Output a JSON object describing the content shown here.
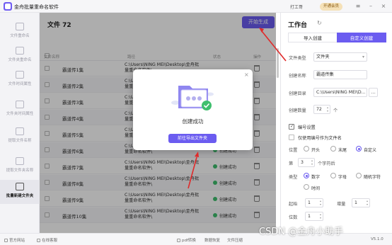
{
  "app": {
    "title": "金舟批量重命名软件",
    "user": "打工哥",
    "vip": "开通会员"
  },
  "sidebar": {
    "items": [
      {
        "label": "文件重命名"
      },
      {
        "label": "文件夹重命名"
      },
      {
        "label": "文件时间属性"
      },
      {
        "label": "文件夹时间属性"
      },
      {
        "label": "提取文件名称"
      },
      {
        "label": "提取文件夹名称"
      },
      {
        "label": "批量新建文件夹"
      }
    ],
    "active_index": 6
  },
  "main": {
    "file_count": "文件 72",
    "start_button": "开始生成",
    "columns": {
      "name": "文件名称",
      "path": "路径",
      "status": "状态",
      "action": "操作"
    },
    "rows": [
      {
        "name": "霸道传1集",
        "path": "C:\\Users\\NING MEI\\Desktop\\金舟批量重命名软件\\",
        "status": ""
      },
      {
        "name": "霸道传2集",
        "path": "C:\\Users\\NING MEI\\Desktop\\金舟批量重命名软件\\",
        "status": ""
      },
      {
        "name": "霸道传3集",
        "path": "C:\\Users\\NING MEI\\Desktop\\金舟批量重命名软件\\",
        "status": ""
      },
      {
        "name": "霸道传4集",
        "path": "C:\\Users\\NING MEI\\Desktop\\金舟批量重命名软件\\",
        "status": ""
      },
      {
        "name": "霸道传5集",
        "path": "C:\\Users\\NING MEI\\Desktop\\金舟批量重命名软件\\",
        "status": ""
      },
      {
        "name": "霸道传6集",
        "path": "C:\\Users\\NING MEI\\Desktop\\金舟批量重命名软件\\",
        "status": "创建成功"
      },
      {
        "name": "霸道传7集",
        "path": "C:\\Users\\NING MEI\\Desktop\\金舟批量重命名软件\\",
        "status": "创建成功"
      },
      {
        "name": "霸道传8集",
        "path": "C:\\Users\\NING MEI\\Desktop\\金舟批量重命名软件\\",
        "status": "创建成功"
      },
      {
        "name": "霸道传9集",
        "path": "C:\\Users\\NING MEI\\Desktop\\金舟批量重命名软件\\",
        "status": "创建成功"
      },
      {
        "name": "霸道传10集",
        "path": "C:\\Users\\NING MEI\\Desktop\\金舟批量重命名软件\\",
        "status": "创建成功"
      }
    ]
  },
  "panel": {
    "title": "工作台",
    "tabs": [
      "导入创建",
      "自定义创建"
    ],
    "active_tab": 1,
    "file_type_label": "文件类型",
    "file_type_value": "文件夹",
    "name_label": "创建名称",
    "name_value": "霸道传集",
    "dir_label": "创建目录",
    "dir_value": "C:\\Users\\NING MEI\\D...",
    "dir_btn": "...",
    "count_label": "创建数量",
    "count_value": "72",
    "count_unit": "个",
    "numbering_label": "编号设置",
    "numbering_checked": true,
    "only_number_label": "仅使用编号作为文件名",
    "position_label": "位置",
    "position_options": [
      "开头",
      "末尾",
      "自定义"
    ],
    "position_selected": 2,
    "pos_prefix": "第",
    "pos_value": "3",
    "pos_suffix": "个字符后",
    "type_label": "类型",
    "type_options": [
      "数字",
      "字母",
      "随机字符",
      "时间"
    ],
    "type_selected": 0,
    "start_label": "起始",
    "start_value": "1",
    "step_label": "增量",
    "step_value": "1",
    "digits_label": "位数",
    "digits_value": "1"
  },
  "modal": {
    "message": "创建成功",
    "button": "前往导出文件夹",
    "close": "×"
  },
  "bottom": {
    "items": [
      "官方网站",
      "在线客服",
      "pdf转换",
      "数据恢复",
      "文件压缩"
    ],
    "version": "V5.1.0"
  },
  "watermark": "CSDN @金舟小助手",
  "colors": {
    "accent": "#6b5cf0",
    "success": "#3fbf6e",
    "arrow": "#e02a2a"
  }
}
